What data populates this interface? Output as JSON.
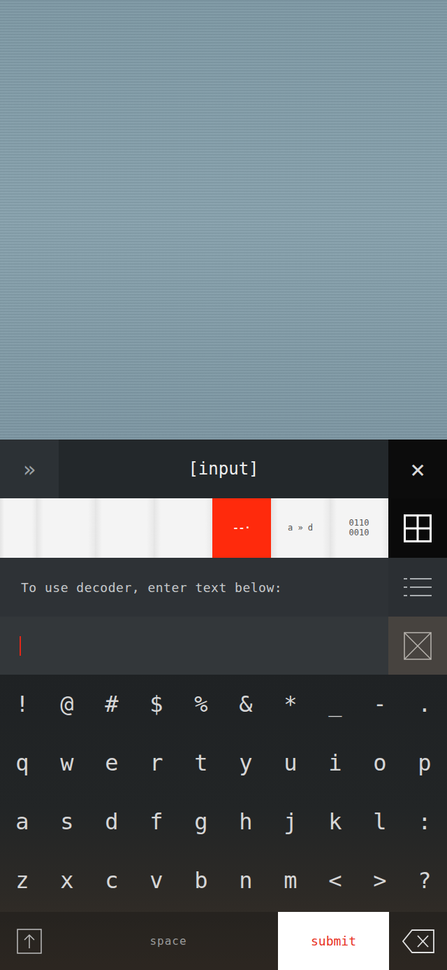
{
  "header": {
    "menu_icon": "»",
    "title": "[input]",
    "close_icon": "×"
  },
  "tabs": [
    {
      "label": "",
      "selected": false
    },
    {
      "label": "",
      "selected": false
    },
    {
      "label": "",
      "selected": false
    },
    {
      "label": "",
      "selected": false
    },
    {
      "label": "--·",
      "selected": true
    },
    {
      "label": "a » d",
      "selected": false
    },
    {
      "label": "0110\n0010",
      "selected": false
    }
  ],
  "decoder": {
    "prompt": "To use decoder, enter text below:",
    "input_value": ""
  },
  "keyboard": {
    "rows": [
      [
        "!",
        "@",
        "#",
        "$",
        "%",
        "&",
        "*",
        "_",
        "-",
        "."
      ],
      [
        "q",
        "w",
        "e",
        "r",
        "t",
        "y",
        "u",
        "i",
        "o",
        "p"
      ],
      [
        "a",
        "s",
        "d",
        "f",
        "g",
        "h",
        "j",
        "k",
        "l",
        ":"
      ],
      [
        "z",
        "x",
        "c",
        "v",
        "b",
        "n",
        "m",
        "<",
        ">",
        "?"
      ]
    ],
    "space": "space",
    "submit": "submit"
  }
}
